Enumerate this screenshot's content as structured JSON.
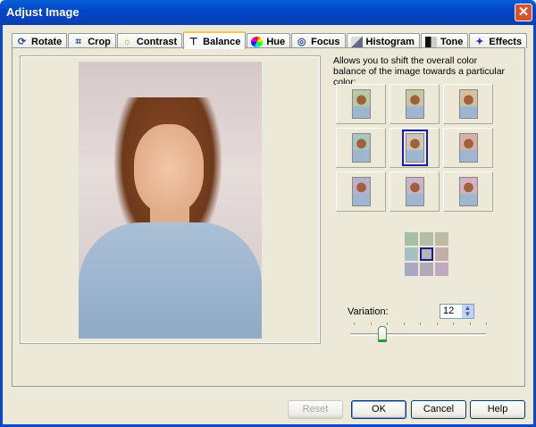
{
  "window": {
    "title": "Adjust Image"
  },
  "tabs": [
    {
      "label": "Rotate",
      "icon": "rotate-icon"
    },
    {
      "label": "Crop",
      "icon": "crop-icon"
    },
    {
      "label": "Contrast",
      "icon": "contrast-icon"
    },
    {
      "label": "Balance",
      "icon": "balance-icon",
      "active": true
    },
    {
      "label": "Hue",
      "icon": "hue-icon"
    },
    {
      "label": "Focus",
      "icon": "focus-icon"
    },
    {
      "label": "Histogram",
      "icon": "histogram-icon"
    },
    {
      "label": "Tone",
      "icon": "tone-icon"
    },
    {
      "label": "Effects",
      "icon": "effects-icon"
    }
  ],
  "balance": {
    "description": "Allows you to shift the overall color balance of the image towards a particular color:",
    "variation_label": "Variation:",
    "variation_value": "12",
    "slider_fraction": 0.24,
    "tints": [
      "#b9c8a6",
      "#c8c4a6",
      "#d2c2a2",
      "#aac4c2",
      "#cfc4b8",
      "#d8b0a8",
      "#b8b0cc",
      "#c8b4c8",
      "#d4b2c4"
    ],
    "swatches": [
      "#a7bfa6",
      "#b5bca7",
      "#bdbba7",
      "#a5c0c0",
      "#b4b7b0",
      "#c2aeab",
      "#a8a8c2",
      "#b2aab9",
      "#bfa9c1"
    ],
    "selected_index": 4
  },
  "buttons": {
    "reset": "Reset",
    "ok": "OK",
    "cancel": "Cancel",
    "help": "Help"
  }
}
